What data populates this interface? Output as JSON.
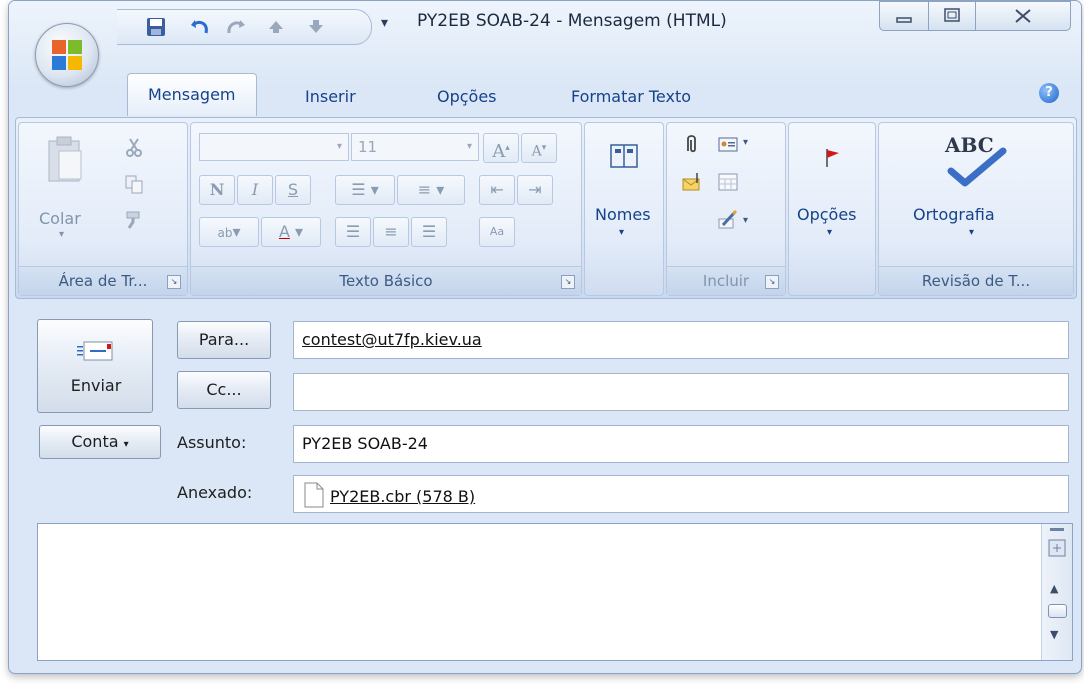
{
  "window": {
    "title": "PY2EB SOAB-24 - Mensagem (HTML)",
    "accent": "#15428b",
    "frame_color": "#dbe7f6"
  },
  "quick_access": {
    "icons": [
      "save-icon",
      "undo-icon",
      "redo-icon",
      "up-arrow-icon",
      "down-arrow-icon"
    ],
    "more_label": "▾"
  },
  "tabs": [
    {
      "label": "Mensagem",
      "active": true
    },
    {
      "label": "Inserir",
      "active": false
    },
    {
      "label": "Opções",
      "active": false
    },
    {
      "label": "Formatar Texto",
      "active": false
    }
  ],
  "ribbon": {
    "clipboard": {
      "label": "Área de Tr...",
      "paste_label": "Colar"
    },
    "basic_text": {
      "label": "Texto Básico",
      "font_size": "11",
      "bold": "N",
      "italic": "I",
      "underline": "S",
      "grow_font": "A",
      "shrink_font": "A"
    },
    "names": {
      "label": "Nomes"
    },
    "include": {
      "label": "Incluir"
    },
    "options": {
      "label": "Opções"
    },
    "review": {
      "label": "Revisão de T...",
      "spelling_label": "Ortografia",
      "spelling_icon_text": "ABC"
    }
  },
  "header": {
    "send_label": "Enviar",
    "to_button": "Para...",
    "cc_button": "Cc...",
    "account_button": "Conta",
    "to_value": "contest@ut7fp.kiev.ua",
    "cc_value": "",
    "subject_label": "Assunto:",
    "subject_value": "PY2EB SOAB-24",
    "attached_label": "Anexado:",
    "attachment_name": "PY2EB.cbr (578 B)"
  },
  "body": {
    "text": ""
  }
}
